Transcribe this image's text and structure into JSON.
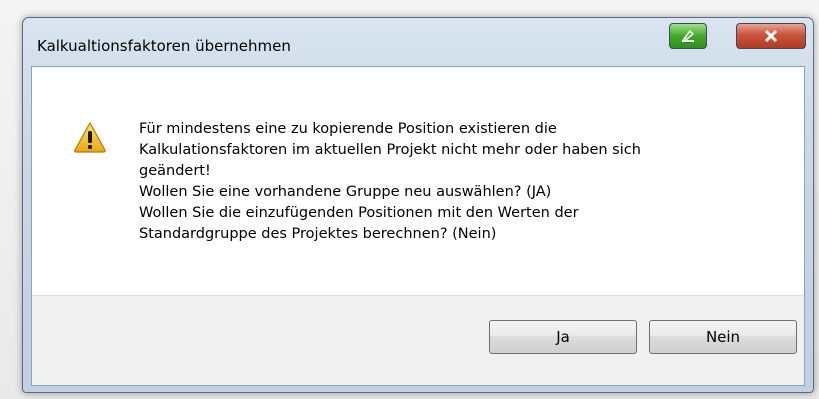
{
  "dialog": {
    "title": "Kalkualtionsfaktoren übernehmen",
    "message_lines": [
      "Für mindestens eine zu kopierende Position existieren die",
      "Kalkulationsfaktoren im aktuellen Projekt nicht mehr oder haben sich",
      "geändert!",
      "Wollen Sie eine vorhandene Gruppe neu auswählen? (JA)",
      "Wollen Sie die einzufügenden Positionen mit den Werten der",
      "Standardgruppe des Projektes berechnen? (Nein)"
    ],
    "icon": "warning-icon",
    "buttons": {
      "yes_label": "Ja",
      "no_label": "Nein"
    },
    "titlebar_buttons": {
      "extra": "pin-icon",
      "close": "close-icon"
    }
  },
  "colors": {
    "title_bar": "#c7d7e6",
    "close_button": "#c9543c",
    "extra_button": "#42a82a",
    "warning": "#f2c230"
  }
}
